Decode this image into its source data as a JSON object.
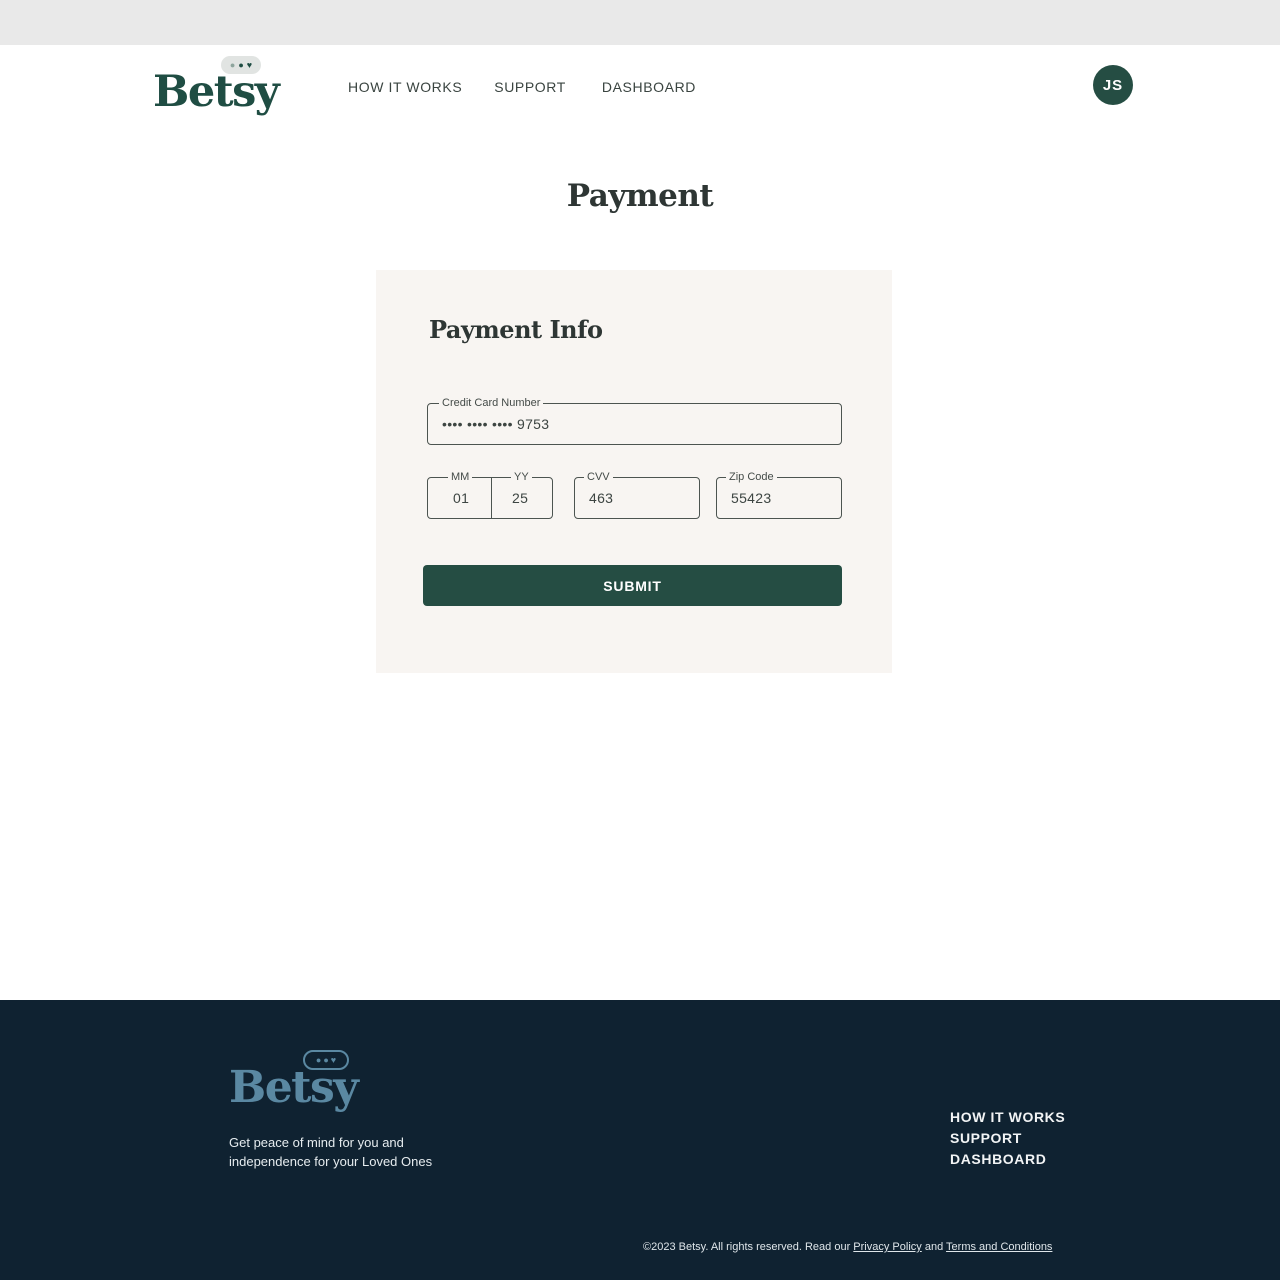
{
  "brand": {
    "name": "Betsy",
    "accent": "#254d43",
    "footer_bg": "#0f2231"
  },
  "nav": {
    "how_it_works": "HOW IT WORKS",
    "support": "SUPPORT",
    "dashboard": "DASHBOARD"
  },
  "user": {
    "initials": "JS"
  },
  "page": {
    "title": "Payment"
  },
  "payment_form": {
    "title": "Payment Info",
    "card_number": {
      "label": "Credit Card Number",
      "value": "•••• •••• •••• 9753"
    },
    "month": {
      "label": "MM",
      "value": "01"
    },
    "year": {
      "label": "YY",
      "value": "25"
    },
    "cvv": {
      "label": "CVV",
      "value": "463"
    },
    "zip": {
      "label": "Zip Code",
      "value": "55423"
    },
    "submit_label": "SUBMIT"
  },
  "footer": {
    "tagline": "Get peace of mind for you and independence for your Loved Ones",
    "links": [
      "HOW IT WORKS",
      "SUPPORT",
      "DASHBOARD"
    ],
    "copyright_prefix": "©2023 Betsy. All rights reserved. Read our",
    "privacy_label": "Privacy Policy",
    "and_text": "and",
    "terms_label": "Terms and Conditions"
  }
}
